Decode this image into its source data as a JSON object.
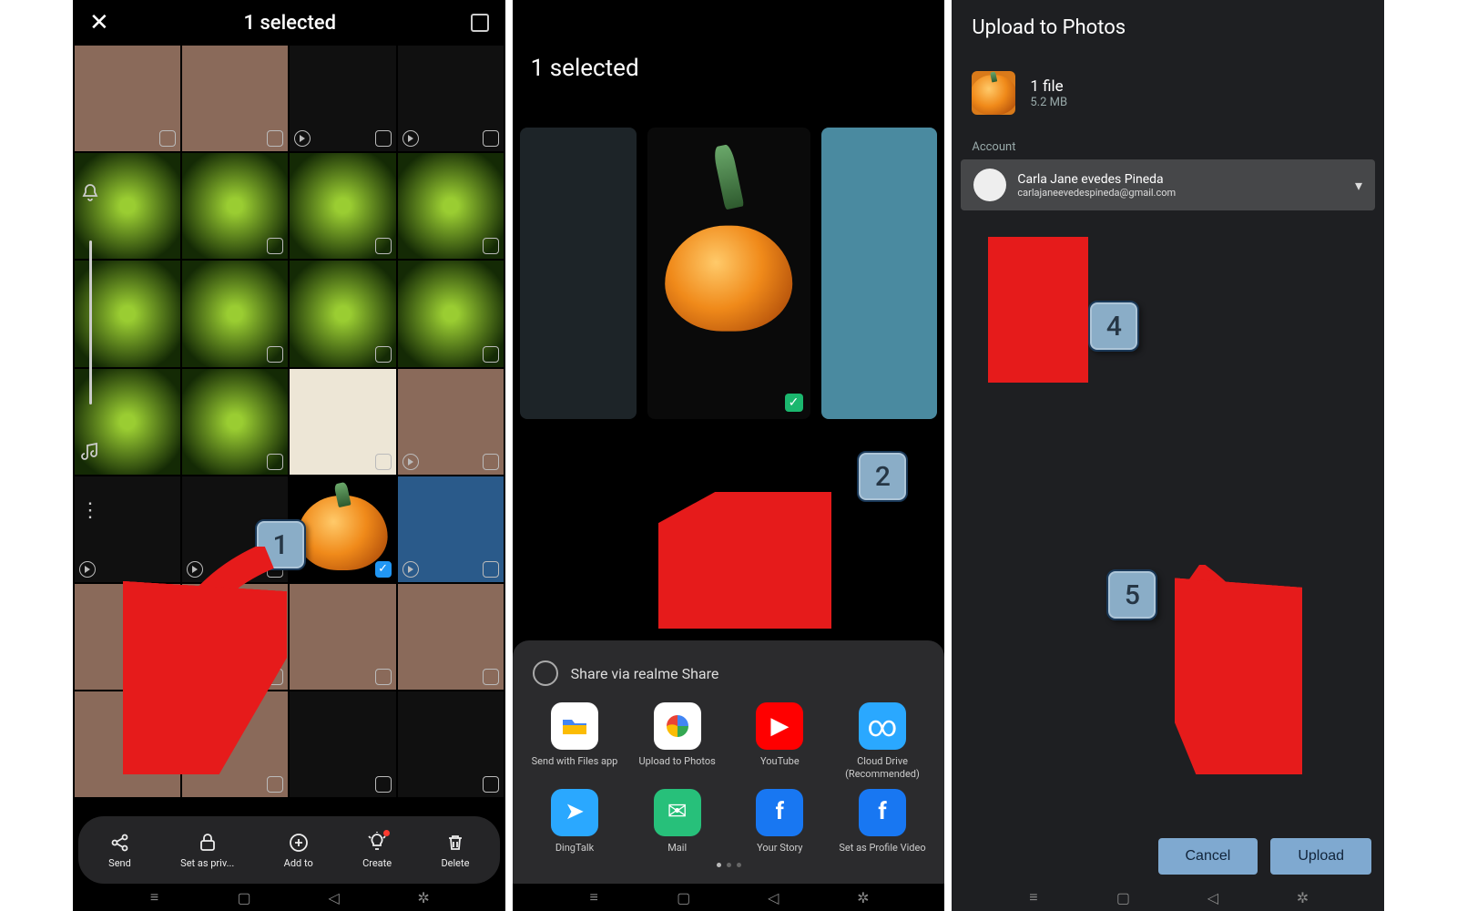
{
  "screen1": {
    "title": "1 selected",
    "bottom": {
      "send": "Send",
      "setpriv": "Set as priv...",
      "addto": "Add to",
      "create": "Create",
      "delete": "Delete"
    },
    "badge": "1"
  },
  "screen2": {
    "title": "1 selected",
    "share_label": "Share via realme Share",
    "apps": {
      "files": "Send with Files app",
      "photos": "Upload to Photos",
      "youtube": "YouTube",
      "cloud": "Cloud Drive (Recommended)",
      "dingtalk": "DingTalk",
      "mail": "Mail",
      "story": "Your Story",
      "profile": "Set as Profile Video"
    },
    "badge": "2"
  },
  "screen3": {
    "title": "Upload to Photos",
    "file_count": "1 file",
    "file_size": "5.2 MB",
    "account_label": "Account",
    "account_name": "Carla Jane evedes Pineda",
    "account_email": "carlajaneevedespineda@gmail.com",
    "cancel": "Cancel",
    "upload": "Upload",
    "badge4": "4",
    "badge5": "5"
  }
}
